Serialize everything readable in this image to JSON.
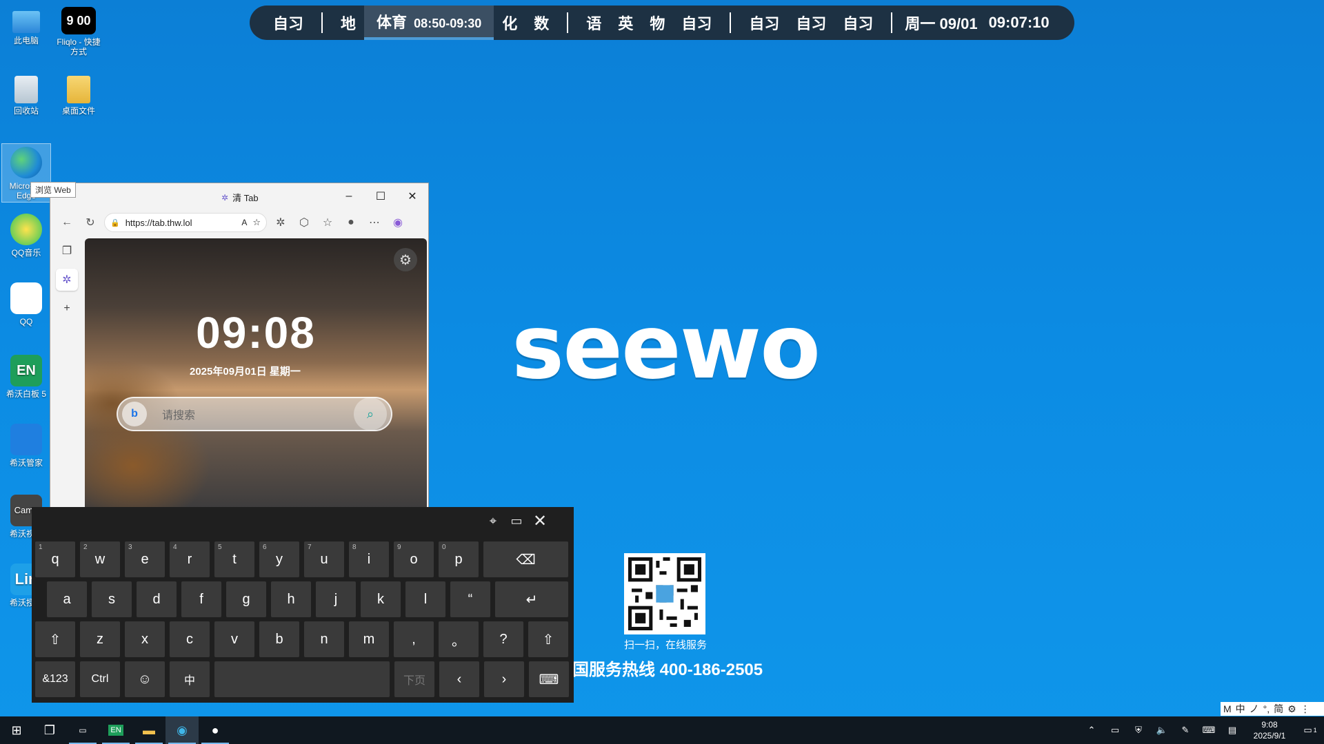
{
  "schedule": {
    "periods_a": [
      "自习"
    ],
    "periods_b": [
      "地"
    ],
    "current": {
      "name": "体育",
      "time": "08:50-09:30"
    },
    "periods_c": [
      "化",
      "数"
    ],
    "periods_d": [
      "语",
      "英",
      "物",
      "自习"
    ],
    "periods_e": [
      "自习",
      "自习",
      "自习"
    ],
    "date": "周一 09/01",
    "clock": "09:07:10"
  },
  "desktop_icons": [
    {
      "label": "此电脑"
    },
    {
      "label": "Fliqlo - 快捷方式"
    },
    {
      "label": "回收站"
    },
    {
      "label": "桌面文件"
    },
    {
      "label": "Microsoft Edge"
    },
    {
      "label": "QQ音乐"
    },
    {
      "label": "QQ"
    },
    {
      "label": "希沃白板 5"
    },
    {
      "label": "希沃管家"
    },
    {
      "label": "希沃视频"
    },
    {
      "label": "希沃授课"
    }
  ],
  "tooltip": "浏览 Web",
  "browser": {
    "tab_title": "清 Tab",
    "url": "https://tab.thw.lol",
    "page": {
      "time": "09:08",
      "date": "2025年09月01日 星期一",
      "search_placeholder": "请搜索"
    }
  },
  "brand": {
    "logo": "seewo",
    "qr_caption": "扫一扫，在线服务",
    "hotline": "国服务热线 400-186-2505"
  },
  "keyboard": {
    "row1": [
      [
        "1",
        "q"
      ],
      [
        "2",
        "w"
      ],
      [
        "3",
        "e"
      ],
      [
        "4",
        "r"
      ],
      [
        "5",
        "t"
      ],
      [
        "6",
        "y"
      ],
      [
        "7",
        "u"
      ],
      [
        "8",
        "i"
      ],
      [
        "9",
        "o"
      ],
      [
        "0",
        "p"
      ]
    ],
    "row2": [
      "a",
      "s",
      "d",
      "f",
      "g",
      "h",
      "j",
      "k",
      "l",
      "“"
    ],
    "row3": [
      "z",
      "x",
      "c",
      "v",
      "b",
      "n",
      "m",
      ",",
      "。",
      "?"
    ],
    "sym_label": "&123",
    "ctrl_label": "Ctrl",
    "lang_label": "中",
    "pagedown_label": "下页"
  },
  "ime": {
    "items": [
      "M",
      "中",
      "ノ",
      "°,",
      "简",
      "⚙",
      "⋮"
    ]
  },
  "taskbar": {
    "clock_time": "9:08",
    "clock_date": "2025/9/1",
    "notif_count": "1"
  }
}
